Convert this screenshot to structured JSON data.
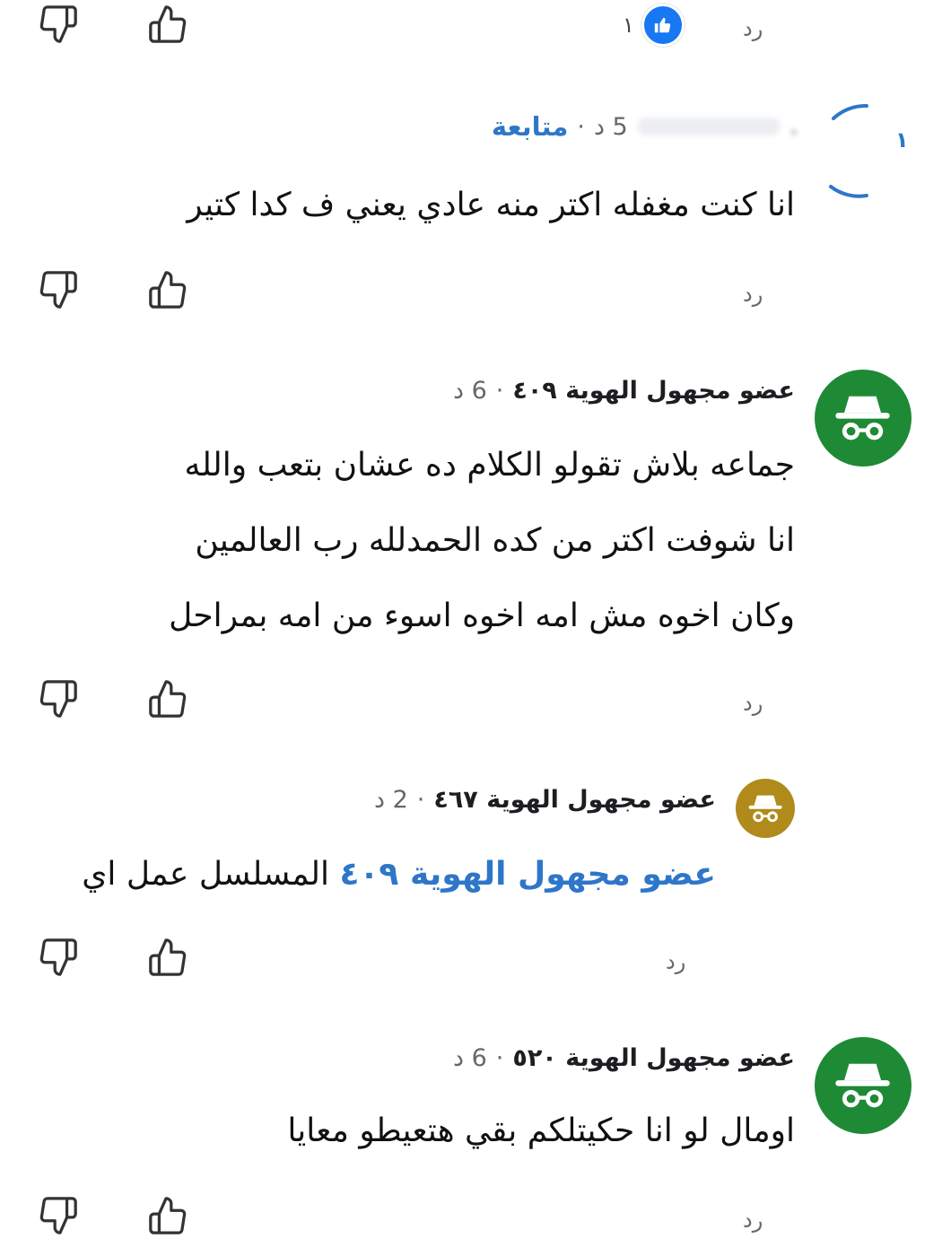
{
  "reply_label": "رد",
  "top_reactions": {
    "count": "١"
  },
  "comments": [
    {
      "author": ".",
      "time": "5 د",
      "sep": "·",
      "follow": "متابعة",
      "lines": [
        "انا كنت مغفله اكتر منه عادي يعني ف كدا كتير"
      ]
    },
    {
      "author": "عضو مجهول الهوية ٤٠٩",
      "time": "6 د",
      "sep": "·",
      "avatar_color": "#1e8a35",
      "lines": [
        "جماعه بلاش تقولو الكلام ده عشان بتعب والله",
        "انا شوفت اكتر من كده الحمدلله رب العالمين",
        "وكان اخوه مش امه اخوه اسوء من امه بمراحل"
      ]
    },
    {
      "author": "عضو مجهول الهوية ٤٦٧",
      "time": "2 د",
      "sep": "·",
      "avatar_color": "#b08a1a",
      "mention": "عضو مجهول الهوية ٤٠٩",
      "text": "المسلسل عمل اي"
    },
    {
      "author": "عضو مجهول الهوية ٥٢٠",
      "time": "6 د",
      "sep": "·",
      "avatar_color": "#1e8a35",
      "lines": [
        "اومال لو انا حكيتلكم بقي هتعيطو معايا"
      ]
    }
  ]
}
